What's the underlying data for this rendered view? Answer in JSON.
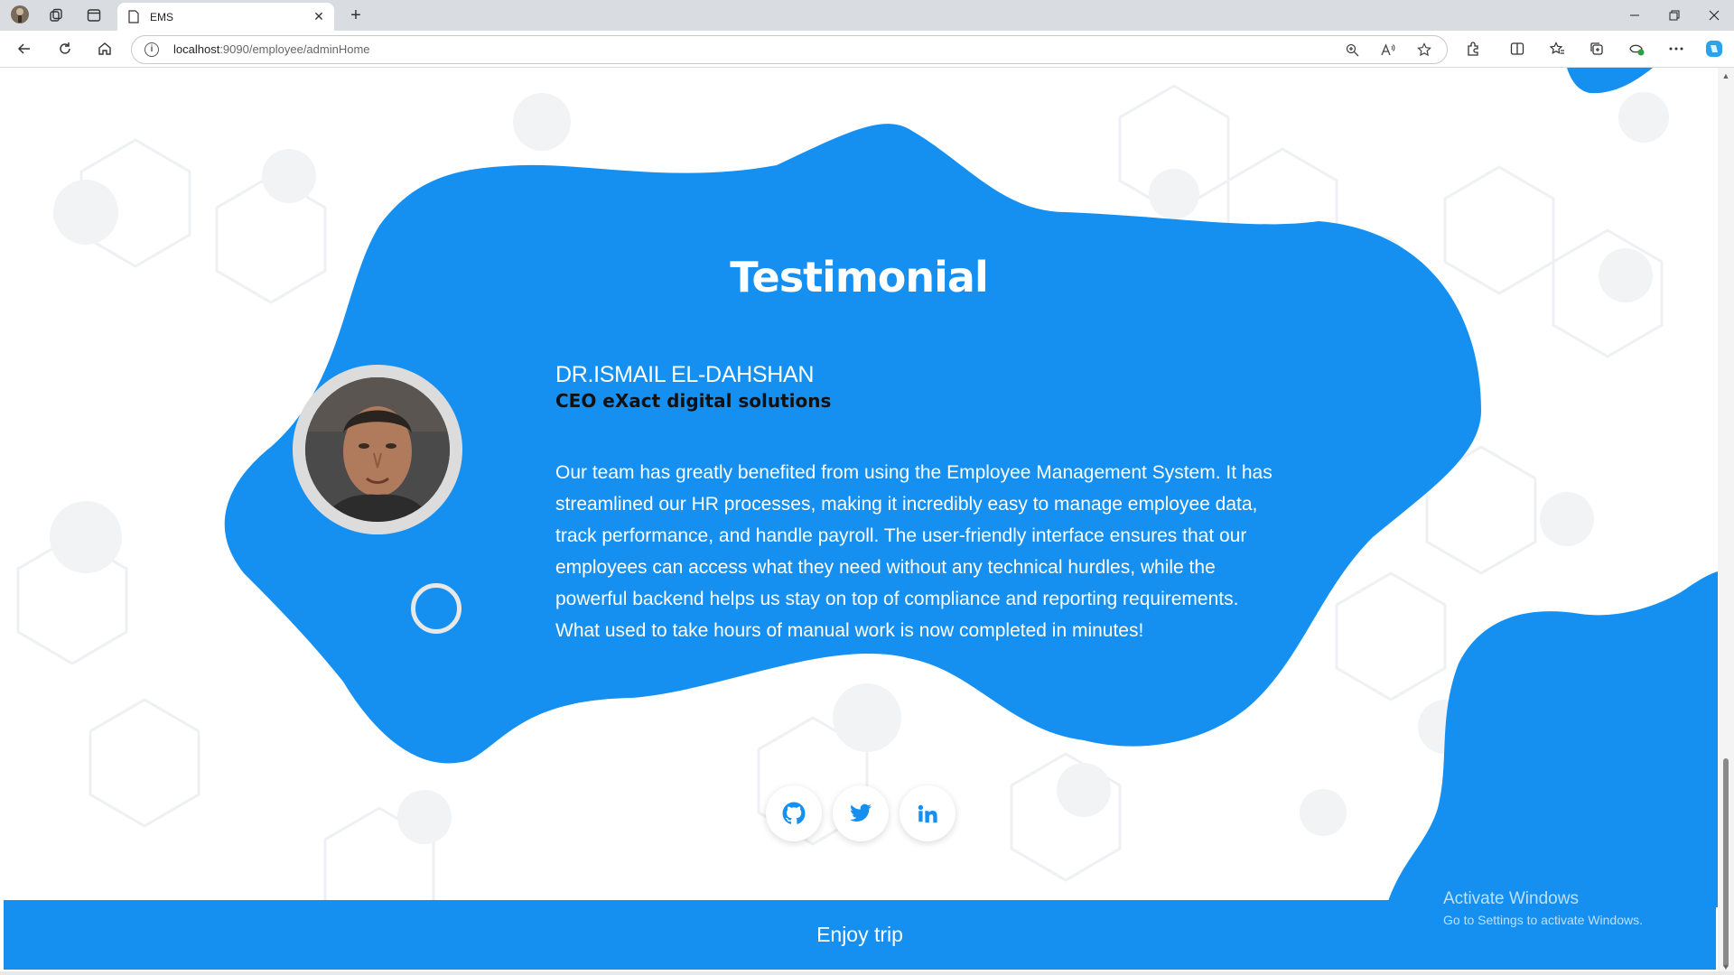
{
  "browser": {
    "tab_title": "EMS",
    "url_host": "localhost",
    "url_path": ":9090/employee/adminHome",
    "new_tab_label": "+",
    "close_tab_label": "✕"
  },
  "page": {
    "heading": "Testimonial",
    "testimonial": {
      "name": "DR.ISMAIL EL-DAHSHAN",
      "role": "CEO eXact digital solutions",
      "quote": "Our team has greatly benefited from using the Employee Management System. It has streamlined our HR processes, making it incredibly easy to manage employee data, track performance, and handle payroll. The user-friendly interface ensures that our employees can access what they need without any technical hurdles, while the powerful backend helps us stay on top of compliance and reporting requirements. What used to take hours of manual work is now completed in minutes!"
    },
    "social": [
      {
        "name": "github-icon"
      },
      {
        "name": "twitter-icon"
      },
      {
        "name": "linkedin-icon"
      }
    ],
    "footer_text": "Enjoy trip"
  },
  "watermark": {
    "line1": "Activate Windows",
    "line2": "Go to Settings to activate Windows."
  },
  "colors": {
    "accent": "#1590f0",
    "footer": "#1590f0",
    "page_bg": "#ffffff"
  }
}
